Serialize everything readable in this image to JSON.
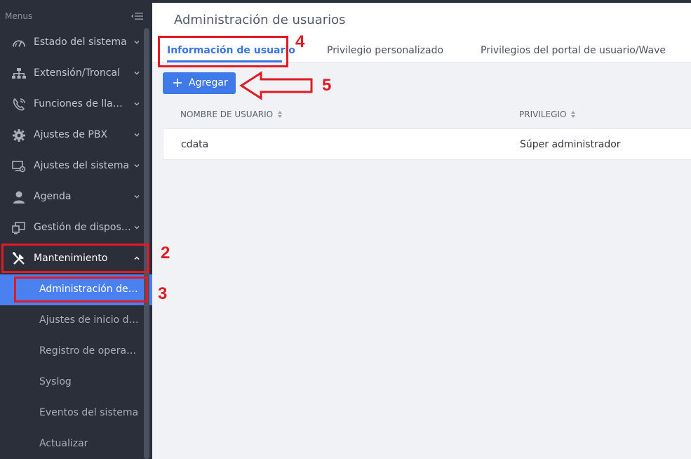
{
  "sidebar": {
    "menus_label": "Menus",
    "items": [
      {
        "label": "Estado del sistema",
        "icon": "speedometer-icon"
      },
      {
        "label": "Extensión/Troncal",
        "icon": "network-tree-icon"
      },
      {
        "label": "Funciones de llamada",
        "icon": "phone-icon"
      },
      {
        "label": "Ajustes de PBX",
        "icon": "gear-icon"
      },
      {
        "label": "Ajustes del sistema",
        "icon": "monitor-gear-icon"
      },
      {
        "label": "Agenda",
        "icon": "user-icon"
      },
      {
        "label": "Gestión de dispositivos",
        "icon": "devices-icon"
      },
      {
        "label": "Mantenimiento",
        "icon": "tools-icon"
      }
    ],
    "subitems": [
      {
        "label": "Administración de usuarios"
      },
      {
        "label": "Ajustes de inicio de sesión"
      },
      {
        "label": "Registro de operaciones"
      },
      {
        "label": "Syslog"
      },
      {
        "label": "Eventos del sistema"
      },
      {
        "label": "Actualizar"
      }
    ]
  },
  "main": {
    "title": "Administración de usuarios",
    "tabs": [
      {
        "label": "Información de usuario"
      },
      {
        "label": "Privilegio personalizado"
      },
      {
        "label": "Privilegios del portal de usuario/Wave"
      }
    ],
    "add_label": "Agregar",
    "table": {
      "columns": [
        "NOMBRE DE USUARIO",
        "PRIVILEGIO"
      ],
      "rows": [
        {
          "username": "cdata",
          "privilege": "Súper administrador"
        }
      ]
    }
  },
  "annotations": [
    "2",
    "3",
    "4",
    "5"
  ],
  "colors": {
    "sidebar_bg": "#2b2f3a",
    "accent": "#3f7ae8",
    "annotation_red": "#e01b24"
  }
}
